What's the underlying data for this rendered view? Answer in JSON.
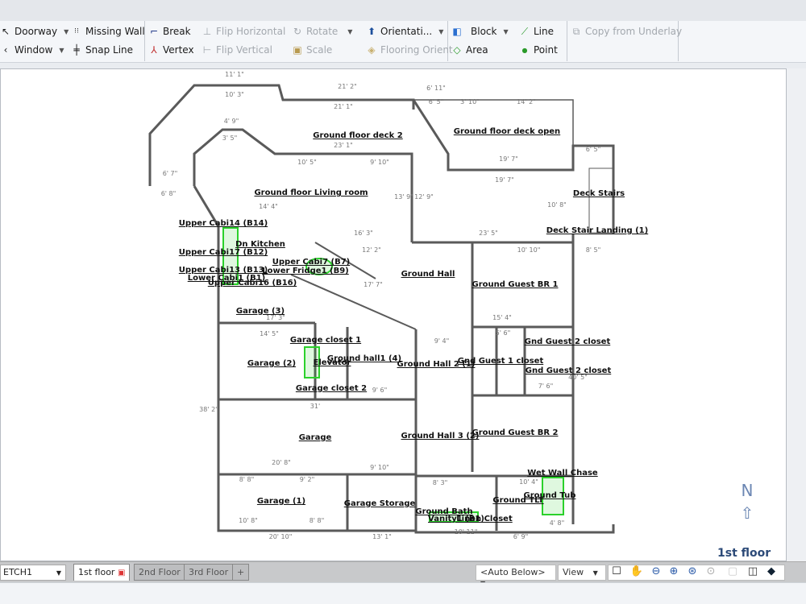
{
  "toolbar": {
    "group1": [
      {
        "label": "Doorway",
        "icon": "doorway-icon",
        "dropdown": true
      },
      {
        "label": "Missing Wall",
        "icon": "missing-wall-icon"
      },
      {
        "label": "Window",
        "icon": "window-icon",
        "dropdown": true
      },
      {
        "label": "Snap Line",
        "icon": "snap-line-icon"
      }
    ],
    "group2": [
      {
        "label": "Break",
        "icon": "break-icon"
      },
      {
        "label": "Flip Horizontal",
        "icon": "flip-horizontal-icon",
        "disabled": true
      },
      {
        "label": "Rotate",
        "icon": "rotate-icon",
        "disabled": true,
        "dropdown": true
      },
      {
        "label": "Orientati...",
        "icon": "orientation-icon",
        "dropdown": true
      },
      {
        "label": "Vertex",
        "icon": "vertex-icon"
      },
      {
        "label": "Flip Vertical",
        "icon": "flip-vertical-icon",
        "disabled": true
      },
      {
        "label": "Scale",
        "icon": "scale-icon",
        "disabled": true
      },
      {
        "label": "Flooring Orient",
        "icon": "flooring-orient-icon",
        "disabled": true
      }
    ],
    "group3": [
      {
        "label": "Block",
        "icon": "block-icon",
        "dropdown": true
      },
      {
        "label": "Line",
        "icon": "line-icon"
      },
      {
        "label": "Area",
        "icon": "area-icon"
      },
      {
        "label": "Point",
        "icon": "point-icon"
      }
    ],
    "group4": [
      {
        "label": "Copy from Underlay",
        "icon": "copy-underlay-icon",
        "disabled": true
      }
    ]
  },
  "plan": {
    "rooms": [
      "Ground floor deck 2",
      "Ground floor deck open",
      "Ground floor Living room",
      "Deck Stairs",
      "Deck Stair Landing  (1)",
      "Upper Cabi14 (B14)",
      "Dn Kitchen",
      "Upper Cabi17 (B12)",
      "Upper Cabi7 (B7)",
      "Upper Cabi13 (B13)",
      "Lower Fridge1 (B9)",
      "Lower Cabi1 (B1)",
      "Upper Cabi16 (B16)",
      "Ground Hall",
      "Ground Guest BR 1",
      "Garage  (3)",
      "Garage closet 1",
      "Garage  (2)",
      "Elevator",
      "Ground  hall1  (4)",
      "Ground Hall 2  (1)",
      "Gnd Guest 1 closet",
      "Gnd Guest 2 closet",
      "Gnd Guest 2 closet",
      "Garage closet 2",
      "Garage",
      "Ground Hall 3  (2)",
      "Ground Guest BR 2",
      "Wet Wall Chase",
      "Ground Tub",
      "Ground TLT",
      "Garage  (1)",
      "Garage Storage",
      "Ground Bath",
      "Vanity1 (B1)",
      "Linen Closet"
    ],
    "dimensions": [
      "11' 1\"",
      "10' 3\"",
      "21' 2\"",
      "21' 1\"",
      "6' 11\"",
      "6' 5\"",
      "3' 10\"",
      "14' 2\"",
      "4' 9\"",
      "3' 5\"",
      "23' 1\"",
      "10' 5\"",
      "9' 10\"",
      "19' 7\"",
      "19' 7\"",
      "6' 5\"",
      "6' 7\"",
      "6' 8\"",
      "14' 4\"",
      "16' 3\"",
      "23' 5\"",
      "12' 2\"",
      "10' 10\"",
      "8' 5\"",
      "17' 3\"",
      "14' 5\"",
      "15' 4\"",
      "5' 6\"",
      "9' 4\"",
      "9' 6\"",
      "31'",
      "20' 8\"",
      "9' 10\"",
      "8' 8\"",
      "9' 2\"",
      "10' 8\"",
      "8' 8\"",
      "8' 3\"",
      "10' 4\"",
      "20' 10\"",
      "13' 1\"",
      "10' 11\"",
      "6' 9\"",
      "4' 8\"",
      "7' 6\"",
      "17' 7\"",
      "13' 9\"",
      "12' 9\"",
      "10' 8\"",
      "38' 2\"",
      "40' 5\""
    ],
    "north_label": "N",
    "floor_label": "1st floor"
  },
  "bottom": {
    "sketch_select": "ETCH1",
    "tabs": [
      {
        "label": "1st floor",
        "active": true
      },
      {
        "label": "2nd Floor"
      },
      {
        "label": "3rd Floor"
      },
      {
        "label": "+"
      }
    ],
    "auto_below": "<Auto Below>",
    "view": "View",
    "tools": [
      "select-rect-icon",
      "pan-hand-icon",
      "zoom-out-icon",
      "zoom-in-icon",
      "zoom-fit-icon",
      "zoom-window-icon",
      "blank-icon",
      "door-icon",
      "3d-view-icon"
    ]
  },
  "colors": {
    "accent": "#2c4a78",
    "fixture": "#2bd12b",
    "wall": "#555555"
  }
}
